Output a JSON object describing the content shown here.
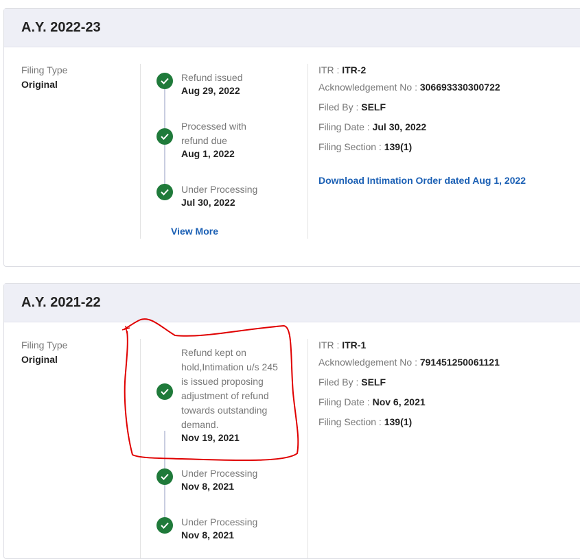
{
  "cards": [
    {
      "title": "A.Y. 2022-23",
      "filing_type_label": "Filing Type",
      "filing_type_value": "Original",
      "timeline": [
        {
          "status": "Refund issued",
          "date": "Aug 29, 2022"
        },
        {
          "status": "Processed with refund due",
          "date": "Aug 1, 2022"
        },
        {
          "status": "Under Processing",
          "date": "Jul 30, 2022"
        }
      ],
      "view_more": "View More",
      "details": {
        "itr_label": "ITR :",
        "itr_value": "ITR-2",
        "ack_label": "Acknowledgement No :",
        "ack_value": "306693330300722",
        "filed_by_label": "Filed By :",
        "filed_by_value": "SELF",
        "filing_date_label": "Filing Date :",
        "filing_date_value": "Jul 30, 2022",
        "filing_section_label": "Filing Section :",
        "filing_section_value": "139(1)"
      },
      "download_link": "Download Intimation Order dated Aug 1, 2022"
    },
    {
      "title": "A.Y. 2021-22",
      "filing_type_label": "Filing Type",
      "filing_type_value": "Original",
      "timeline": [
        {
          "status": "Refund kept on hold,Intimation u/s 245 is issued proposing adjustment of refund towards outstanding demand.",
          "date": "Nov 19, 2021"
        },
        {
          "status": "Under Processing",
          "date": "Nov 8, 2021"
        },
        {
          "status": "Under Processing",
          "date": "Nov 8, 2021"
        }
      ],
      "details": {
        "itr_label": "ITR :",
        "itr_value": "ITR-1",
        "ack_label": "Acknowledgement No :",
        "ack_value": "791451250061121",
        "filed_by_label": "Filed By :",
        "filed_by_value": "SELF",
        "filing_date_label": "Filing Date :",
        "filing_date_value": "Nov 6, 2021",
        "filing_section_label": "Filing Section :",
        "filing_section_value": "139(1)"
      }
    }
  ],
  "icons": {
    "status_check": "check-circle-icon",
    "annotation": "red-freehand-circle"
  },
  "colors": {
    "check_green": "#1f7a3a",
    "link_blue": "#1a5fb4",
    "header_bg": "#eeeff6",
    "annotation_red": "#e00000"
  }
}
